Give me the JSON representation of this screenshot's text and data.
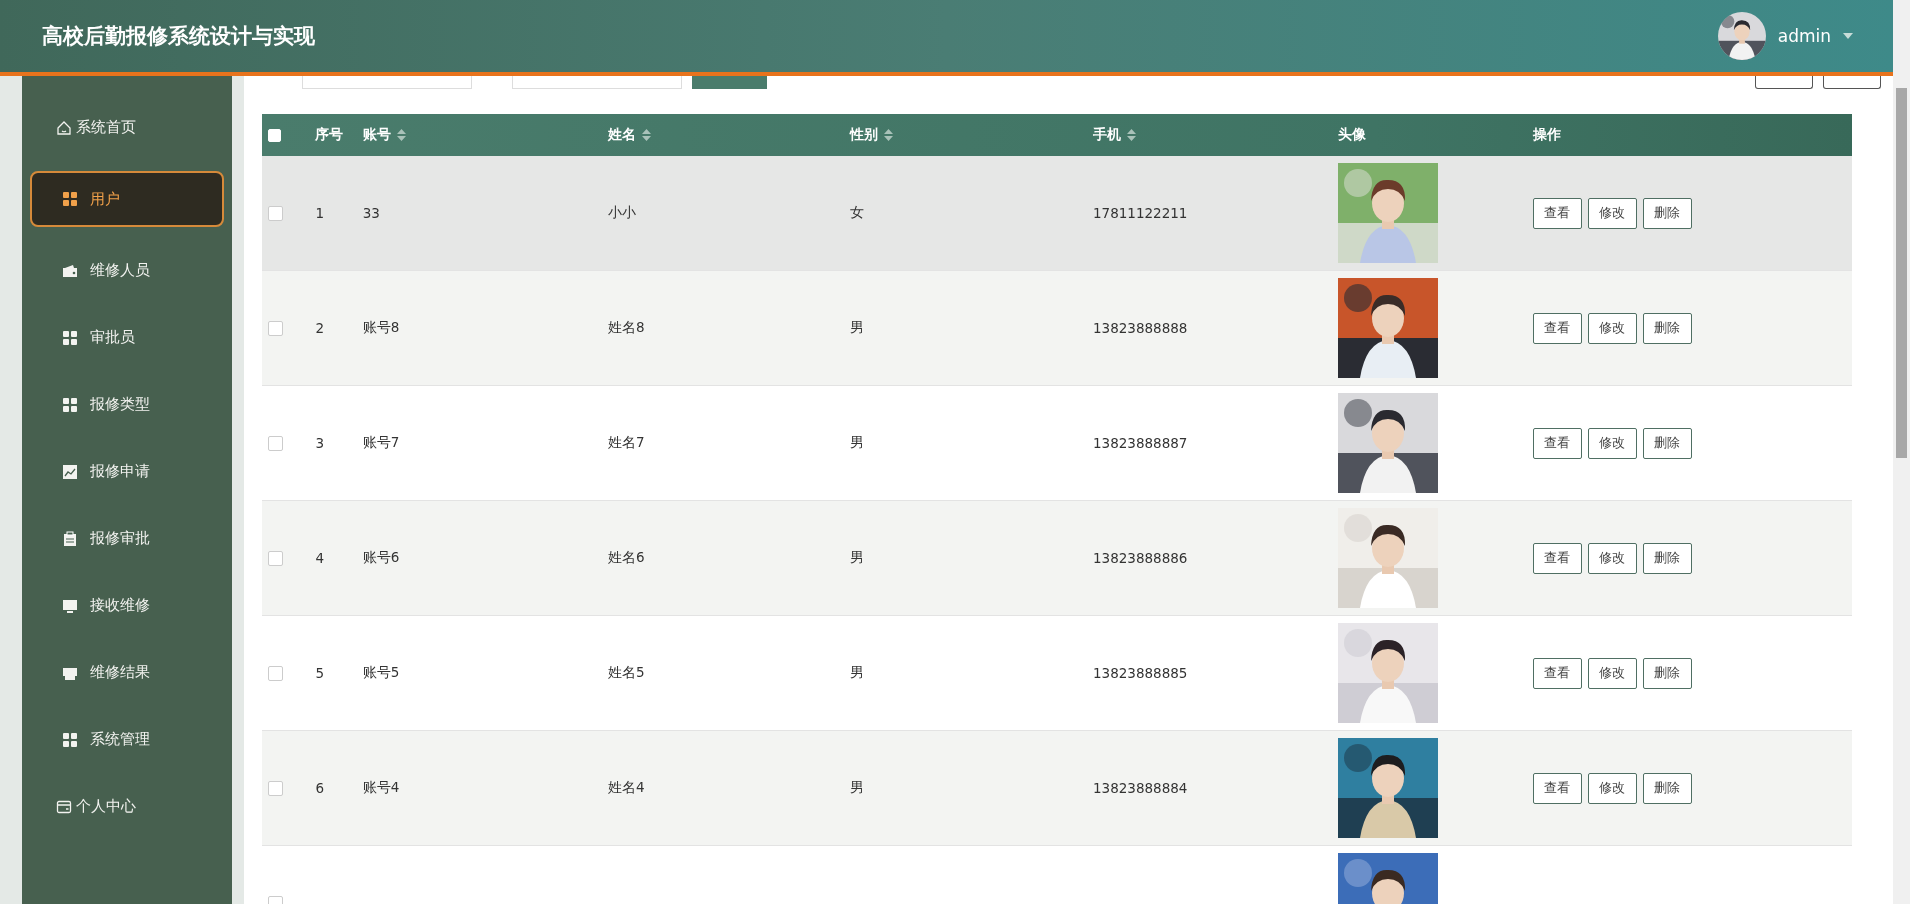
{
  "header": {
    "title": "高校后勤报修系统设计与实现",
    "user": {
      "name": "admin"
    }
  },
  "sidebar": {
    "items": [
      {
        "label": "系统首页",
        "kind": "top",
        "selected": false
      },
      {
        "label": "用户",
        "kind": "sub",
        "selected": true
      },
      {
        "label": "维修人员",
        "kind": "sub",
        "selected": false
      },
      {
        "label": "审批员",
        "kind": "sub",
        "selected": false
      },
      {
        "label": "报修类型",
        "kind": "sub",
        "selected": false
      },
      {
        "label": "报修申请",
        "kind": "sub",
        "selected": false
      },
      {
        "label": "报修审批",
        "kind": "sub",
        "selected": false
      },
      {
        "label": "接收维修",
        "kind": "sub",
        "selected": false
      },
      {
        "label": "维修结果",
        "kind": "sub",
        "selected": false
      },
      {
        "label": "系统管理",
        "kind": "sub",
        "selected": false
      },
      {
        "label": "个人中心",
        "kind": "top",
        "selected": false
      }
    ]
  },
  "table": {
    "all_checked": false,
    "columns": [
      {
        "label": "序号",
        "sortable": false
      },
      {
        "label": "账号",
        "sortable": true
      },
      {
        "label": "姓名",
        "sortable": true
      },
      {
        "label": "性别",
        "sortable": true
      },
      {
        "label": "手机",
        "sortable": true
      },
      {
        "label": "头像",
        "sortable": false
      },
      {
        "label": "操作",
        "sortable": false
      }
    ],
    "rows": [
      {
        "checked": false,
        "highlighted": true,
        "index": "1",
        "account": "33",
        "name": "小小",
        "gender": "女",
        "phone": "17811122211",
        "actions": [
          "查看",
          "修改",
          "删除"
        ]
      },
      {
        "checked": false,
        "highlighted": false,
        "index": "2",
        "account": "账号8",
        "name": "姓名8",
        "gender": "男",
        "phone": "13823888888",
        "actions": [
          "查看",
          "修改",
          "删除"
        ]
      },
      {
        "checked": false,
        "highlighted": false,
        "index": "3",
        "account": "账号7",
        "name": "姓名7",
        "gender": "男",
        "phone": "13823888887",
        "actions": [
          "查看",
          "修改",
          "删除"
        ]
      },
      {
        "checked": false,
        "highlighted": false,
        "index": "4",
        "account": "账号6",
        "name": "姓名6",
        "gender": "男",
        "phone": "13823888886",
        "actions": [
          "查看",
          "修改",
          "删除"
        ]
      },
      {
        "checked": false,
        "highlighted": false,
        "index": "5",
        "account": "账号5",
        "name": "姓名5",
        "gender": "男",
        "phone": "13823888885",
        "actions": [
          "查看",
          "修改",
          "删除"
        ]
      },
      {
        "checked": false,
        "highlighted": false,
        "index": "6",
        "account": "账号4",
        "name": "姓名4",
        "gender": "男",
        "phone": "13823888884",
        "actions": [
          "查看",
          "修改",
          "删除"
        ]
      },
      {
        "checked": false,
        "highlighted": false
      }
    ]
  }
}
